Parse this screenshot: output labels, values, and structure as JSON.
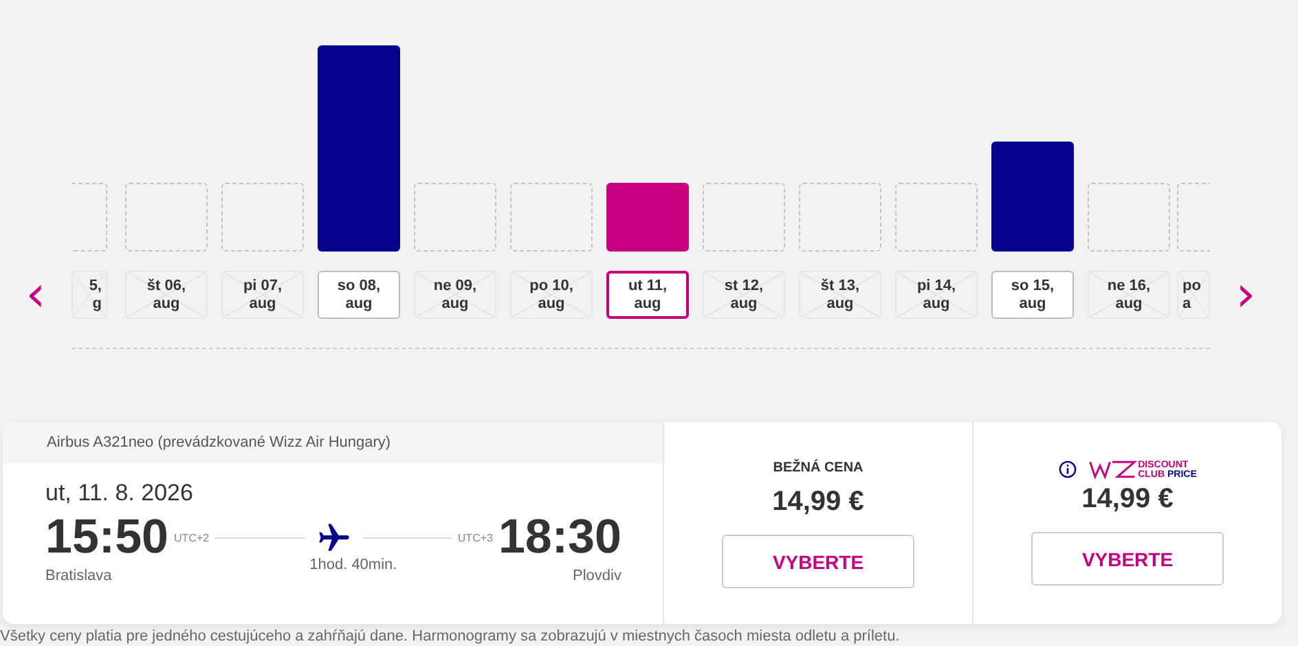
{
  "date_strip": {
    "prev_arrow": "‹",
    "next_arrow": "›",
    "days": [
      {
        "kind": "empty",
        "day": "5,",
        "month": "g",
        "cut_left": true,
        "available": false,
        "selected": false
      },
      {
        "kind": "empty",
        "day": "št 06,",
        "month": "aug",
        "available": false,
        "selected": false
      },
      {
        "kind": "empty",
        "day": "pi 07,",
        "month": "aug",
        "available": false,
        "selected": false
      },
      {
        "kind": "tall",
        "day": "so 08,",
        "month": "aug",
        "available": true,
        "selected": false
      },
      {
        "kind": "empty",
        "day": "ne 09,",
        "month": "aug",
        "available": false,
        "selected": false
      },
      {
        "kind": "empty",
        "day": "po 10,",
        "month": "aug",
        "available": false,
        "selected": false
      },
      {
        "kind": "short",
        "day": "ut 11,",
        "month": "aug",
        "available": true,
        "selected": true
      },
      {
        "kind": "empty",
        "day": "st 12,",
        "month": "aug",
        "available": false,
        "selected": false
      },
      {
        "kind": "empty",
        "day": "št 13,",
        "month": "aug",
        "available": false,
        "selected": false
      },
      {
        "kind": "empty",
        "day": "pi 14,",
        "month": "aug",
        "available": false,
        "selected": false
      },
      {
        "kind": "mid",
        "day": "so 15,",
        "month": "aug",
        "available": true,
        "selected": false
      },
      {
        "kind": "empty",
        "day": "ne 16,",
        "month": "aug",
        "available": false,
        "selected": false
      },
      {
        "kind": "empty",
        "day": "po",
        "month": "a",
        "cut_right": true,
        "available": false,
        "selected": false
      }
    ]
  },
  "flight": {
    "aircraft": "Airbus A321neo (prevádzkované Wizz Air Hungary)",
    "date": "ut, 11. 8. 2026",
    "departure": {
      "time": "15:50",
      "utc": "UTC+2",
      "city": "Bratislava"
    },
    "arrival": {
      "time": "18:30",
      "utc": "UTC+3",
      "city": "Plovdiv"
    },
    "duration": "1hod. 40min."
  },
  "fares": [
    {
      "kind": "regular",
      "label": "BEŽNÁ CENA",
      "price": "14,99 €",
      "button": "VYBERTE"
    },
    {
      "kind": "club",
      "logo_word": "DISCOUNT",
      "logo_line2a": "CLUB",
      "logo_line2b": "PRICE",
      "price": "14,99 €",
      "button": "VYBERTE"
    }
  ],
  "footnote": "Všetky ceny platia pre jedného cestujúceho a zahŕňajú dane. Harmonogramy sa zobrazujú v miestnych časoch miesta odletu a príletu."
}
